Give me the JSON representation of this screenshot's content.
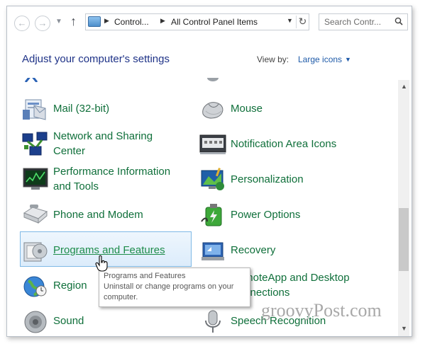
{
  "toolbar": {
    "back_icon": "arrow-left-icon",
    "forward_icon": "arrow-right-icon",
    "up_icon": "arrow-up-icon",
    "breadcrumbs": [
      "Control...",
      "All Control Panel Items"
    ],
    "search_placeholder": "Search Contr..."
  },
  "header": {
    "title": "Adjust your computer's settings",
    "view_by_label": "View by:",
    "view_by_value": "Large icons"
  },
  "items": {
    "mail": "Mail (32-bit)",
    "mouse": "Mouse",
    "network_1": "Network and Sharing",
    "network_2": "Center",
    "notification": "Notification Area Icons",
    "performance_1": "Performance Information",
    "performance_2": "and Tools",
    "personalization": "Personalization",
    "phone": "Phone and Modem",
    "power": "Power Options",
    "programs": "Programs and Features",
    "recovery": "Recovery",
    "region": "Region",
    "remoteapp_1": "RemoteApp and Desktop",
    "remoteapp_2": "Connections",
    "sound": "Sound",
    "speech": "Speech Recognition"
  },
  "tooltip": {
    "line1": "Programs and Features",
    "line2": "Uninstall or change programs on your",
    "line3": "computer."
  },
  "watermark": "groovyPost.com",
  "colors": {
    "link_green": "#0f6f3a",
    "title_blue": "#1e3287",
    "selection": "#dcecfb"
  }
}
